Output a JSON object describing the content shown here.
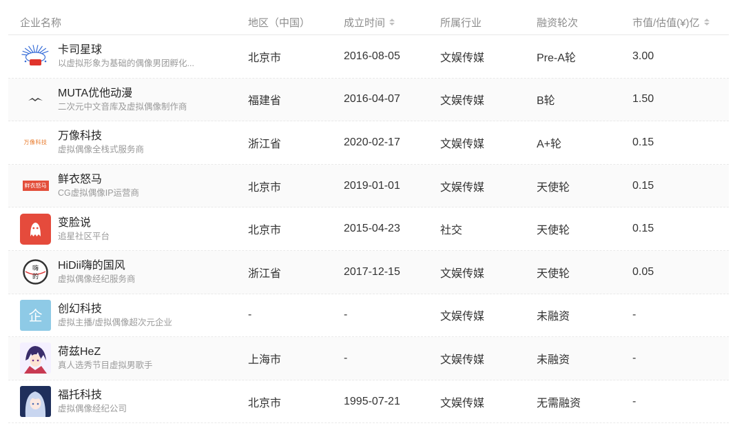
{
  "headers": {
    "name": "企业名称",
    "region": "地区（中国）",
    "founded": "成立时间",
    "industry": "所属行业",
    "round": "融资轮次",
    "valuation": "市值/估值(¥)亿"
  },
  "rows": [
    {
      "name": "卡司星球",
      "desc": "以虚拟形象为基础的偶像男团孵化...",
      "logo": "star-burst-logo",
      "region": "北京市",
      "founded": "2016-08-05",
      "industry": "文娱传媒",
      "round": "Pre-A轮",
      "valuation": "3.00"
    },
    {
      "name": "MUTA优他动漫",
      "desc": "二次元中文音库及虚拟偶像制作商",
      "logo": "bird-logo",
      "region": "福建省",
      "founded": "2016-04-07",
      "industry": "文娱传媒",
      "round": "B轮",
      "valuation": "1.50"
    },
    {
      "name": "万像科技",
      "desc": "虚拟偶像全栈式服务商",
      "logo": "text-logo",
      "logo_text": "万像科技",
      "region": "浙江省",
      "founded": "2020-02-17",
      "industry": "文娱传媒",
      "round": "A+轮",
      "valuation": "0.15"
    },
    {
      "name": "鲜衣怒马",
      "desc": "CG虚拟偶像IP运营商",
      "logo": "text-badge-logo",
      "logo_text": "鲜衣怒马",
      "region": "北京市",
      "founded": "2019-01-01",
      "industry": "文娱传媒",
      "round": "天使轮",
      "valuation": "0.15"
    },
    {
      "name": "变脸说",
      "desc": "追星社区平台",
      "logo": "ghost-logo",
      "region": "北京市",
      "founded": "2015-04-23",
      "industry": "社交",
      "round": "天使轮",
      "valuation": "0.15"
    },
    {
      "name": "HiDii嗨的国风",
      "desc": "虚拟偶像经纪服务商",
      "logo": "seal-logo",
      "logo_text": "嗨 的",
      "region": "浙江省",
      "founded": "2017-12-15",
      "industry": "文娱传媒",
      "round": "天使轮",
      "valuation": "0.05"
    },
    {
      "name": "创幻科技",
      "desc": "虚拟主播/虚拟偶像超次元企业",
      "logo": "placeholder-logo",
      "logo_text": "企",
      "region": "-",
      "founded": "-",
      "industry": "文娱传媒",
      "round": "未融资",
      "valuation": "-"
    },
    {
      "name": "荷兹HeZ",
      "desc": "真人选秀节目虚拟男歌手",
      "logo": "anime-boy-logo",
      "region": "上海市",
      "founded": "-",
      "industry": "文娱传媒",
      "round": "未融资",
      "valuation": "-"
    },
    {
      "name": "福托科技",
      "desc": "虚拟偶像经纪公司",
      "logo": "anime-girl-logo",
      "region": "北京市",
      "founded": "1995-07-21",
      "industry": "文娱传媒",
      "round": "无需融资",
      "valuation": "-"
    }
  ]
}
